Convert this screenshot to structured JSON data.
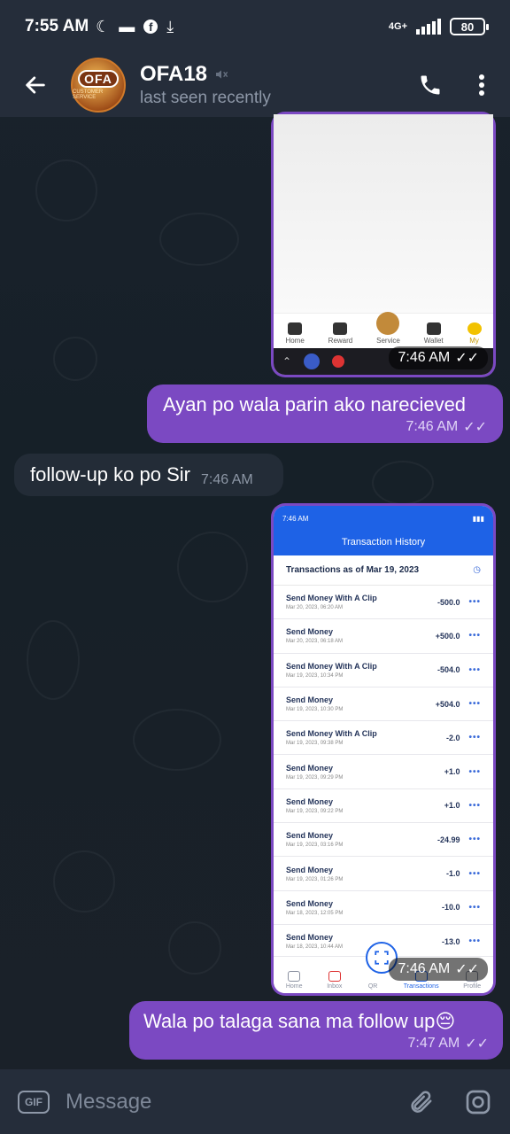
{
  "status_bar": {
    "time": "7:55 AM",
    "network": "4G+",
    "battery": "80"
  },
  "header": {
    "contact_name": "OFA18",
    "contact_status": "last seen recently",
    "avatar_text": "OFA",
    "avatar_subtext": "CUSTOMER SERVICE"
  },
  "messages": {
    "img1": {
      "time": "7:46 AM",
      "nav": [
        "Home",
        "Reward",
        "Service",
        "Wallet",
        "My"
      ]
    },
    "m1": {
      "text": "Ayan po wala parin ako narecieved",
      "time": "7:46 AM"
    },
    "m2": {
      "text": "follow-up ko po Sir",
      "time": "7:46 AM"
    },
    "img2": {
      "time": "7:46 AM",
      "phone_time": "7:46 AM",
      "title": "Transaction History",
      "heading": "Transactions as of Mar 19, 2023",
      "rows": [
        {
          "title": "Send Money With A Clip",
          "date": "Mar 20, 2023, 06:20 AM",
          "amount": "-500.0"
        },
        {
          "title": "Send Money",
          "date": "Mar 20, 2023, 06:18 AM",
          "amount": "+500.0"
        },
        {
          "title": "Send Money With A Clip",
          "date": "Mar 19, 2023, 10:34 PM",
          "amount": "-504.0"
        },
        {
          "title": "Send Money",
          "date": "Mar 19, 2023, 10:30 PM",
          "amount": "+504.0"
        },
        {
          "title": "Send Money With A Clip",
          "date": "Mar 19, 2023, 09:38 PM",
          "amount": "-2.0"
        },
        {
          "title": "Send Money",
          "date": "Mar 19, 2023, 09:29 PM",
          "amount": "+1.0"
        },
        {
          "title": "Send Money",
          "date": "Mar 19, 2023, 09:22 PM",
          "amount": "+1.0"
        },
        {
          "title": "Send Money",
          "date": "Mar 19, 2023, 03:16 PM",
          "amount": "-24.99"
        },
        {
          "title": "Send Money",
          "date": "Mar 19, 2023, 01:26 PM",
          "amount": "-1.0"
        },
        {
          "title": "Send Money",
          "date": "Mar 18, 2023, 12:05 PM",
          "amount": "-10.0"
        },
        {
          "title": "Send Money",
          "date": "Mar 18, 2023, 10:44 AM",
          "amount": "-13.0"
        }
      ],
      "nav": [
        "Home",
        "Inbox",
        "QR",
        "Transactions",
        "Profile"
      ]
    },
    "m3": {
      "text": "Wala po talaga sana ma follow up😔",
      "time": "7:47 AM"
    }
  },
  "input": {
    "gif_label": "GIF",
    "placeholder": "Message"
  }
}
